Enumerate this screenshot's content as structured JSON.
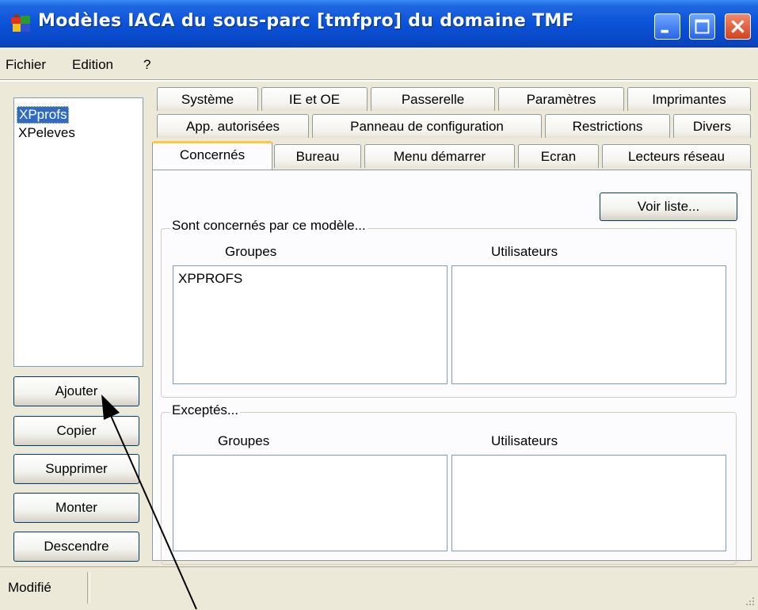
{
  "window": {
    "title": "Modèles IACA du sous-parc [tmfpro] du domaine TMF",
    "icon": "app-icon"
  },
  "menu": [
    "Fichier",
    "Edition",
    "?"
  ],
  "models_list": {
    "items": [
      "XPprofs",
      "XPeleves"
    ],
    "selected": "XPprofs"
  },
  "left_buttons": [
    "Ajouter",
    "Copier",
    "Supprimer",
    "Monter",
    "Descendre"
  ],
  "tabs": {
    "row1": [
      "Système",
      "IE et OE",
      "Passerelle",
      "Paramètres",
      "Imprimantes"
    ],
    "row2": [
      "App. autorisées",
      "Panneau de configuration",
      "Restrictions",
      "Divers"
    ],
    "row3": [
      "Concernés",
      "Bureau",
      "Menu démarrer",
      "Ecran",
      "Lecteurs réseau"
    ],
    "active": "Concernés"
  },
  "concernes": {
    "voir_liste": "Voir liste...",
    "included": {
      "legend": "Sont concernés par ce modèle...",
      "groups_header": "Groupes",
      "users_header": "Utilisateurs",
      "groups": [
        "XPPROFS"
      ],
      "users": []
    },
    "excluded": {
      "legend": "Exceptés...",
      "groups_header": "Groupes",
      "users_header": "Utilisateurs",
      "groups": [],
      "users": []
    }
  },
  "status": {
    "text": "Modifié"
  },
  "colors": {
    "titlebar": "#0a52d8",
    "selection": "#316ac5",
    "active_tab_accent": "#ffc83c"
  }
}
